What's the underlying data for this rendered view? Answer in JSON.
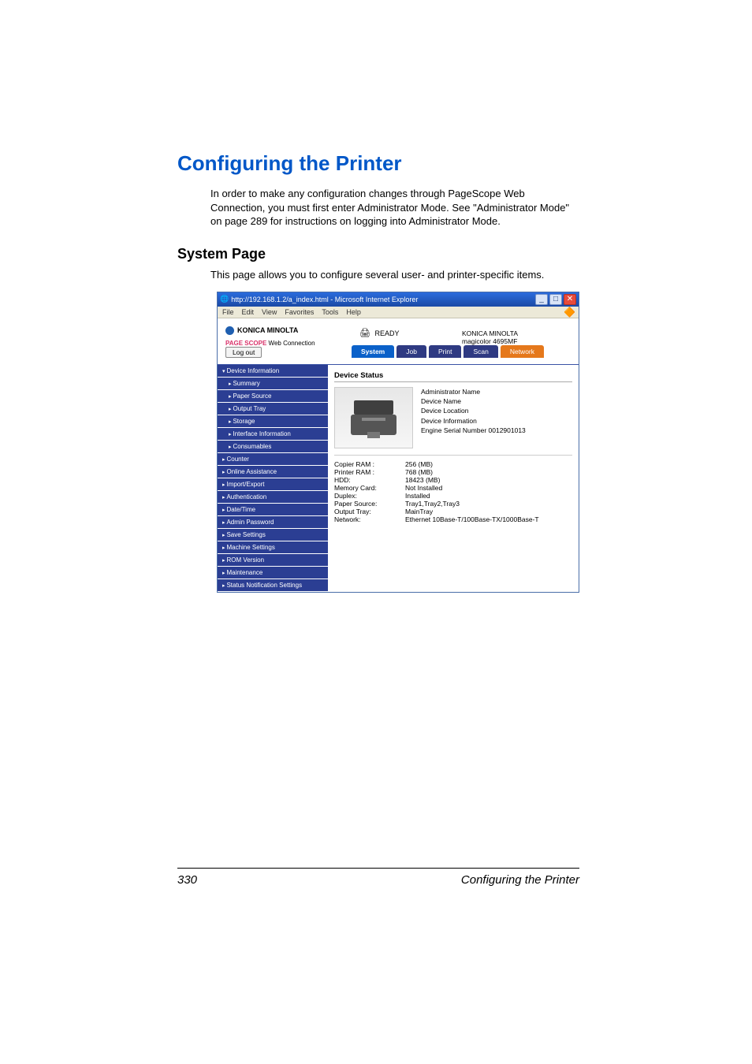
{
  "doc": {
    "heading1": "Configuring the Printer",
    "intro": "In order to make any configuration changes through PageScope Web Connection, you must first enter Administrator Mode. See \"Administrator Mode\" on page 289 for instructions on logging into Administrator Mode.",
    "heading2": "System Page",
    "caption": "This page allows you to configure several user- and printer-specific items.",
    "footer_left": "330",
    "footer_right": "Configuring the Printer"
  },
  "window": {
    "title": "http://192.168.1.2/a_index.html - Microsoft Internet Explorer",
    "menu": [
      "File",
      "Edit",
      "View",
      "Favorites",
      "Tools",
      "Help"
    ]
  },
  "brand": {
    "company": "KONICA MINOLTA",
    "pagescope_prefix": "PAGE SCOPE",
    "pagescope_label": "Web Connection",
    "ready": "READY",
    "model_line1": "KONICA MINOLTA",
    "model_line2": "magicolor 4695MF",
    "logout": "Log out"
  },
  "tabs": [
    "System",
    "Job",
    "Print",
    "Scan",
    "Network"
  ],
  "sidebar": {
    "heading": "Device Information",
    "sub": [
      "Summary",
      "Paper Source",
      "Output Tray",
      "Storage",
      "Interface Information",
      "Consumables"
    ],
    "top": [
      "Counter",
      "Online Assistance",
      "Import/Export",
      "Authentication",
      "Date/Time",
      "Admin Password",
      "Save Settings",
      "Machine Settings",
      "ROM Version",
      "Maintenance",
      "Status Notification Settings"
    ]
  },
  "main": {
    "section_title": "Device Status",
    "labels": [
      "Administrator Name",
      "Device Name",
      "Device Location",
      "Device Information",
      "Engine Serial Number  0012901013"
    ],
    "specs": [
      {
        "k": "Copier RAM :",
        "v": "256 (MB)"
      },
      {
        "k": "Printer RAM :",
        "v": "768 (MB)"
      },
      {
        "k": "HDD:",
        "v": "18423 (MB)"
      },
      {
        "k": "Memory Card:",
        "v": "Not Installed"
      },
      {
        "k": "Duplex:",
        "v": "Installed"
      },
      {
        "k": "Paper Source:",
        "v": "Tray1,Tray2,Tray3"
      },
      {
        "k": "Output Tray:",
        "v": "MainTray"
      },
      {
        "k": "Network:",
        "v": "Ethernet 10Base-T/100Base-TX/1000Base-T"
      }
    ]
  }
}
